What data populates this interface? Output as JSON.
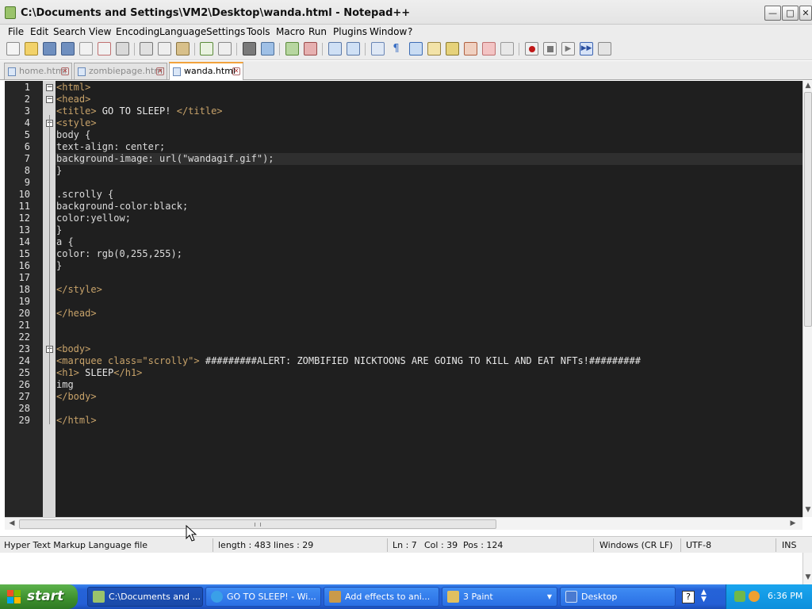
{
  "window": {
    "title": "C:\\Documents and Settings\\VM2\\Desktop\\wanda.html - Notepad++",
    "buttons": {
      "minimize": "—",
      "maximize": "□",
      "close": "✕"
    }
  },
  "menu": [
    "File",
    "Edit",
    "Search",
    "View",
    "Encoding",
    "Language",
    "Settings",
    "Tools",
    "Macro",
    "Run",
    "Plugins",
    "Window",
    "?"
  ],
  "tabs": [
    {
      "label": "home.html",
      "active": false
    },
    {
      "label": "zombiepage.html",
      "active": false
    },
    {
      "label": "wanda.html",
      "active": true
    }
  ],
  "editor": {
    "current_line": 7,
    "lines": [
      {
        "n": "1",
        "text": "<html>"
      },
      {
        "n": "2",
        "text": "<head>"
      },
      {
        "n": "3",
        "text": "<title> GO TO SLEEP! </title>"
      },
      {
        "n": "4",
        "text": "<style>"
      },
      {
        "n": "5",
        "text": "body {"
      },
      {
        "n": "6",
        "text": "text-align: center;"
      },
      {
        "n": "7",
        "text": "background-image: url(\"wandagif.gif\");"
      },
      {
        "n": "8",
        "text": "}"
      },
      {
        "n": "9",
        "text": ""
      },
      {
        "n": "10",
        "text": ".scrolly {"
      },
      {
        "n": "11",
        "text": "background-color:black;"
      },
      {
        "n": "12",
        "text": "color:yellow;"
      },
      {
        "n": "13",
        "text": "}"
      },
      {
        "n": "14",
        "text": "a {"
      },
      {
        "n": "15",
        "text": "color: rgb(0,255,255);"
      },
      {
        "n": "16",
        "text": "}"
      },
      {
        "n": "17",
        "text": ""
      },
      {
        "n": "18",
        "text": "</style>"
      },
      {
        "n": "19",
        "text": ""
      },
      {
        "n": "20",
        "text": "</head>"
      },
      {
        "n": "21",
        "text": ""
      },
      {
        "n": "22",
        "text": ""
      },
      {
        "n": "23",
        "text": "<body>"
      },
      {
        "n": "24",
        "text": "<marquee class=\"scrolly\"> #########ALERT: ZOMBIFIED NICKTOONS ARE GOING TO KILL AND EAT NFTs!#########"
      },
      {
        "n": "25",
        "text": "<h1> SLEEP</h1>"
      },
      {
        "n": "26",
        "text": "img"
      },
      {
        "n": "27",
        "text": "</body>"
      },
      {
        "n": "28",
        "text": ""
      },
      {
        "n": "29",
        "text": "</html>"
      }
    ]
  },
  "status": {
    "filetype": "Hyper Text Markup Language file",
    "length": "length : 483",
    "lines": "lines : 29",
    "ln": "Ln : 7",
    "col": "Col : 39",
    "pos": "Pos : 124",
    "eol": "Windows (CR LF)",
    "encoding": "UTF-8",
    "mode": "INS"
  },
  "taskbar": {
    "start_label": "start",
    "tasks": [
      {
        "label": "C:\\Documents and ...",
        "active": true
      },
      {
        "label": "GO TO SLEEP! - Wi...",
        "active": false
      },
      {
        "label": "Add effects to ani...",
        "active": false
      },
      {
        "label": "3 Paint",
        "active": false
      },
      {
        "label": "Desktop",
        "active": false
      }
    ],
    "clock": "6:36 PM"
  },
  "colors": {
    "editor_bg": "#1f1f1f",
    "tag": "#c8a36a",
    "taskbar": "#245fd6",
    "start": "#3c8f2d"
  }
}
